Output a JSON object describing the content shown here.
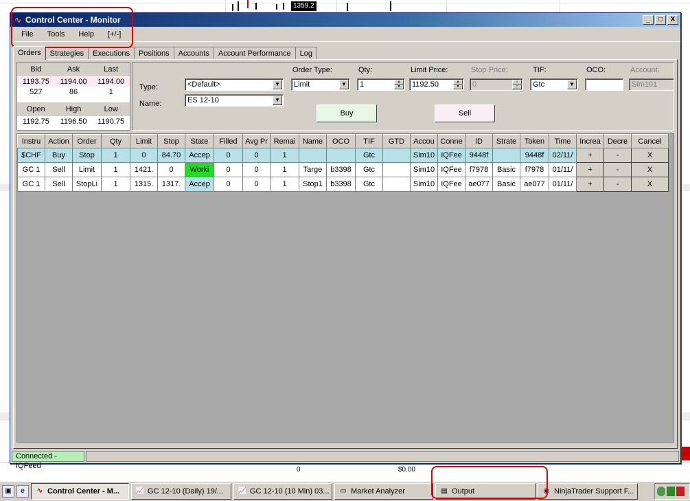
{
  "background": {
    "price_tag": "1359.2",
    "footer_left": "0",
    "footer_right": "$0.00"
  },
  "window": {
    "title": "Control Center - Monitor",
    "controls": [
      "_",
      "□",
      "X"
    ]
  },
  "menu": [
    "File",
    "Tools",
    "Help",
    "[+/-]"
  ],
  "tabs": [
    "Orders",
    "Strategies",
    "Executions",
    "Positions",
    "Accounts",
    "Account Performance",
    "Log"
  ],
  "quote": {
    "headers1": [
      "Bid",
      "Ask",
      "Last"
    ],
    "values1": [
      "1193.75",
      "1194.00",
      "1194.00"
    ],
    "values2": [
      "527",
      "86",
      "1"
    ],
    "headers2": [
      "Open",
      "High",
      "Low"
    ],
    "values3": [
      "1192.75",
      "1196.50",
      "1190.75"
    ]
  },
  "entry": {
    "type_label": "Type:",
    "type_value": "<Default>",
    "name_label": "Name:",
    "name_value": "ES 12-10",
    "order_type_label": "Order Type:",
    "order_type_value": "Limit",
    "qty_label": "Qty:",
    "qty_value": "1",
    "limit_price_label": "Limit Price:",
    "limit_price_value": "1192.50",
    "stop_price_label": "Stop Price:",
    "stop_price_value": "0",
    "tif_label": "TIF:",
    "tif_value": "Gtc",
    "oco_label": "OCO:",
    "oco_value": "",
    "account_label": "Account:",
    "account_value": "Sim101",
    "buy_label": "Buy",
    "sell_label": "Sell"
  },
  "orders": {
    "columns": [
      "Instru",
      "Action",
      "Order",
      "Qty",
      "Limit",
      "Stop",
      "State",
      "Filled",
      "Avg Pr",
      "Remai",
      "Name",
      "OCO",
      "TIF",
      "GTD",
      "Accou",
      "Conne",
      "ID",
      "Strate",
      "Token",
      "Time",
      "Increa",
      "Decre",
      "Cancel"
    ],
    "rows": [
      [
        "$CHF",
        "Buy",
        "Stop",
        "1",
        "0",
        "84.70",
        "Accep",
        "0",
        "0",
        "1",
        "",
        "",
        "Gtc",
        "",
        "Sim10",
        "IQFee",
        "9448f",
        "",
        "9448f",
        "02/11/",
        "+",
        "-",
        "X"
      ],
      [
        "GC 1",
        "Sell",
        "Limit",
        "1",
        "1421.",
        "0",
        "Worki",
        "0",
        "0",
        "1",
        "Targe",
        "b3398",
        "Gtc",
        "",
        "Sim10",
        "IQFee",
        "f7978",
        "Basic",
        "f7978",
        "01/11/",
        "+",
        "-",
        "X"
      ],
      [
        "GC 1",
        "Sell",
        "StopLi",
        "1",
        "1315.",
        "1317.",
        "Accep",
        "0",
        "0",
        "1",
        "Stop1",
        "b3398",
        "Gtc",
        "",
        "Sim10",
        "IQFee",
        "ae077",
        "Basic",
        "ae077",
        "01/11/",
        "+",
        "-",
        "X"
      ]
    ]
  },
  "status": "Connected - IQFeed",
  "taskbar": {
    "tasks": [
      {
        "label": "Control Center - M...",
        "icon": "ninjatrader-icon"
      },
      {
        "label": "GC 12-10 (Daily)  19/...",
        "icon": "chart-icon"
      },
      {
        "label": "GC 12-10 (10 Min)  03...",
        "icon": "chart-icon"
      },
      {
        "label": "Market Analyzer",
        "icon": "window-icon"
      },
      {
        "label": "Output",
        "icon": "output-icon"
      },
      {
        "label": "NinjaTrader Support F...",
        "icon": "browser-icon"
      }
    ]
  },
  "colors": {
    "window_bg": "#d4d0c8",
    "title_gradient_start": "#0a246a",
    "accepted_row": "#b8e0e8",
    "working_state": "#22dd22",
    "connected_bg": "#b6f0b6",
    "annotation": "#e00000"
  }
}
